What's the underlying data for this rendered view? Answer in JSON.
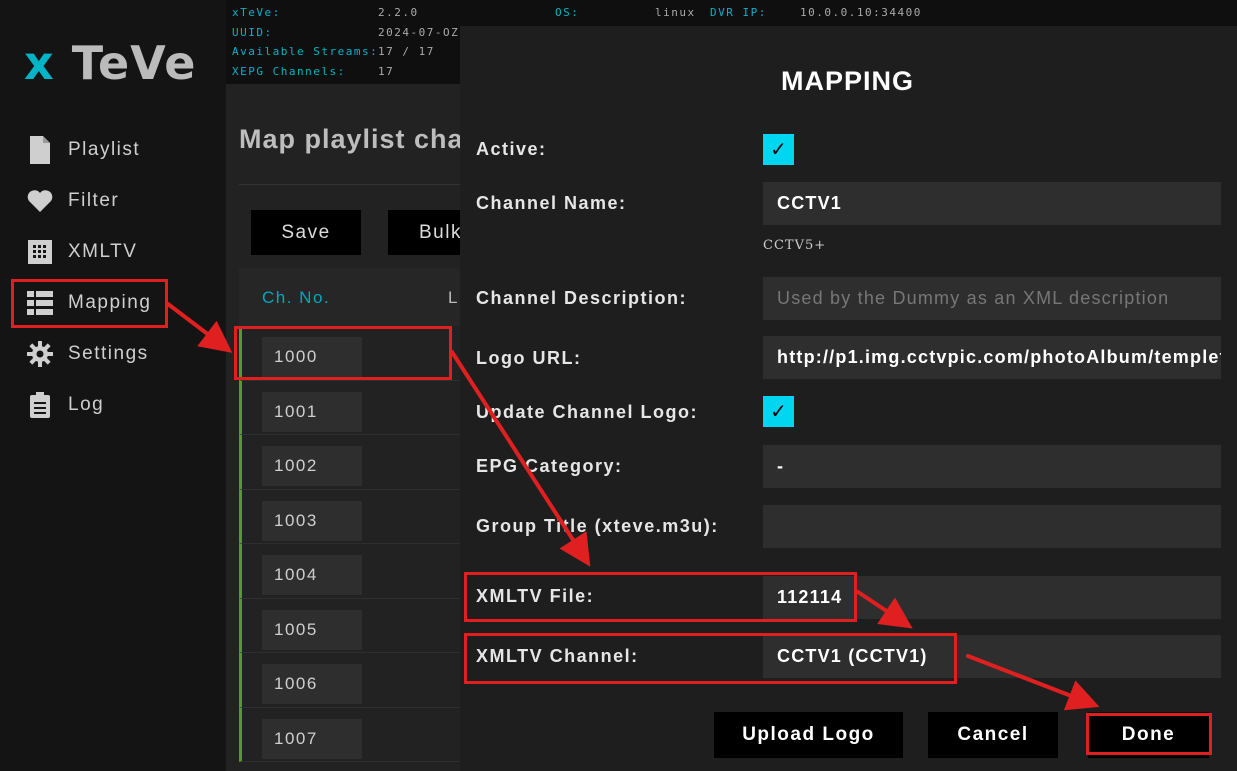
{
  "status": {
    "rows": [
      {
        "label": "xTeVe:",
        "value": "2.2.0"
      },
      {
        "label": "UUID:",
        "value": "2024-07-OZ"
      },
      {
        "label": "Available Streams:",
        "value": "17 / 17"
      },
      {
        "label": "XEPG Channels:",
        "value": "17"
      }
    ],
    "os_label": "OS:",
    "os_value": "linux",
    "dvr_label": "DVR IP:",
    "dvr_value": "10.0.0.10:34400"
  },
  "sidebar": {
    "logo_x": "x",
    "logo_rest": "TeVe",
    "items": [
      {
        "label": "Playlist",
        "icon": "document-icon"
      },
      {
        "label": "Filter",
        "icon": "heart-icon"
      },
      {
        "label": "XMLTV",
        "icon": "grid-icon"
      },
      {
        "label": "Mapping",
        "icon": "list-icon"
      },
      {
        "label": "Settings",
        "icon": "gear-icon"
      },
      {
        "label": "Log",
        "icon": "clipboard-icon"
      }
    ]
  },
  "main": {
    "title": "Map playlist cha",
    "save_label": "Save",
    "bulk_label": "Bulk",
    "col_chno": "Ch. No.",
    "col_logo": "L",
    "rows": [
      "1000",
      "1001",
      "1002",
      "1003",
      "1004",
      "1005",
      "1006",
      "1007"
    ]
  },
  "modal": {
    "title": "MAPPING",
    "active_label": "Active:",
    "check_mark": "✓",
    "channel_name_label": "Channel Name:",
    "channel_name_value": "CCTV1",
    "channel_name_hint": "CCTV5+",
    "desc_label": "Channel Description:",
    "desc_placeholder": "Used by the Dummy as an XML description",
    "logo_url_label": "Logo URL:",
    "logo_url_value": "http://p1.img.cctvpic.com/photoAlbum/templet",
    "update_logo_label": "Update Channel Logo:",
    "epg_label": "EPG Category:",
    "epg_value": "-",
    "group_label": "Group Title (xteve.m3u):",
    "group_value": "",
    "xmltv_file_label": "XMLTV File:",
    "xmltv_file_value": "112114",
    "xmltv_channel_label": "XMLTV Channel:",
    "xmltv_channel_value": "CCTV1 (CCTV1)",
    "upload_label": "Upload Logo",
    "cancel_label": "Cancel",
    "done_label": "Done"
  },
  "colors": {
    "accent": "#00b4c8",
    "checkbox": "#00d6f0",
    "row_marker": "#5a9a20",
    "annotation": "#e02020"
  }
}
